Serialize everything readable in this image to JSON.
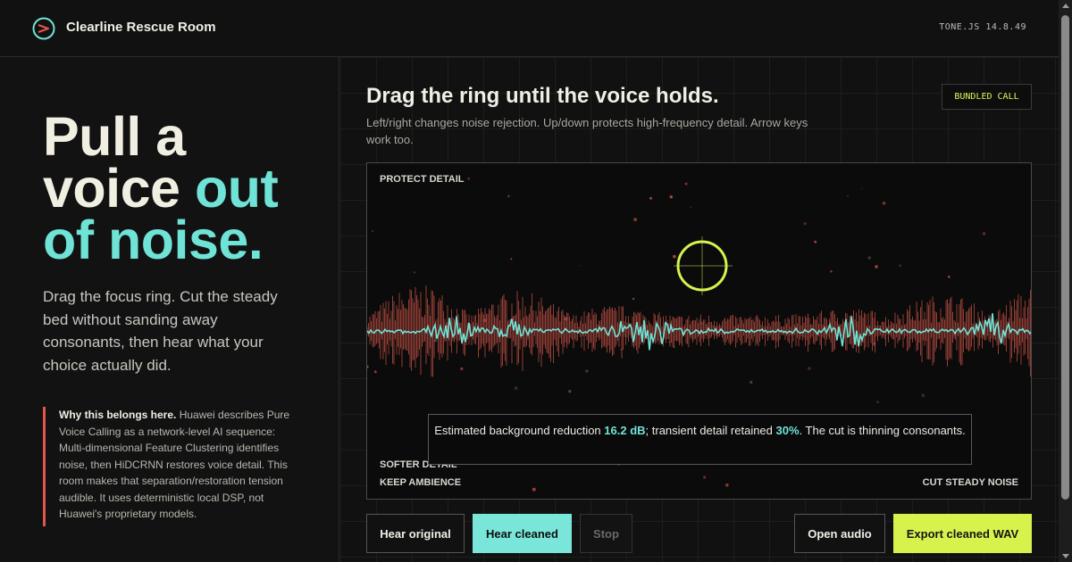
{
  "header": {
    "brand": "Clearline Rescue Room",
    "logo_icon": "chevron-right-circle-icon",
    "version": "TONE.JS 14.8.49"
  },
  "hero": {
    "line1": "Pull a",
    "line2a": "voice ",
    "line2b": "out",
    "line3": "of noise.",
    "lede": "Drag the focus ring. Cut the steady bed without sanding away consonants, then hear what your choice actually did.",
    "callout_bold": "Why this belongs here.",
    "callout_text": " Huawei describes Pure Voice Calling as a network-level AI sequence: Multi-dimensional Feature Clustering identifies noise, then HiDCRNN restores voice detail. This room makes that separation/restoration tension audible. It uses deterministic local DSP, not Huawei's proprietary models."
  },
  "panel": {
    "title": "Drag the ring until the voice holds.",
    "subtitle": "Left/right changes noise rejection. Up/down protects high-frequency detail. Arrow keys work too.",
    "badge": "BUNDLED CALL",
    "corners": {
      "top_left": "PROTECT DETAIL",
      "bottom_left_1": "SOFTER DETAIL",
      "bottom_left_2": "KEEP AMBIENCE",
      "bottom_right": "CUT STEADY NOISE"
    },
    "focus": {
      "noise_rejection": 0.5,
      "detail_protection": 0.67
    },
    "readout": {
      "prefix": "Estimated background reduction ",
      "reduction": "16.2 dB",
      "middle": "; transient detail retained ",
      "retained": "30%",
      "suffix": ". The cut is thinning consonants."
    }
  },
  "buttons": {
    "hear_original": "Hear original",
    "hear_cleaned": "Hear cleaned",
    "stop": "Stop",
    "open_audio": "Open audio",
    "export": "Export cleaned WAV"
  },
  "colors": {
    "accent_teal": "#6fe3d6",
    "accent_lime": "#d7f24d",
    "noise_red": "#b0463a",
    "callout_bar": "#e2574c"
  }
}
